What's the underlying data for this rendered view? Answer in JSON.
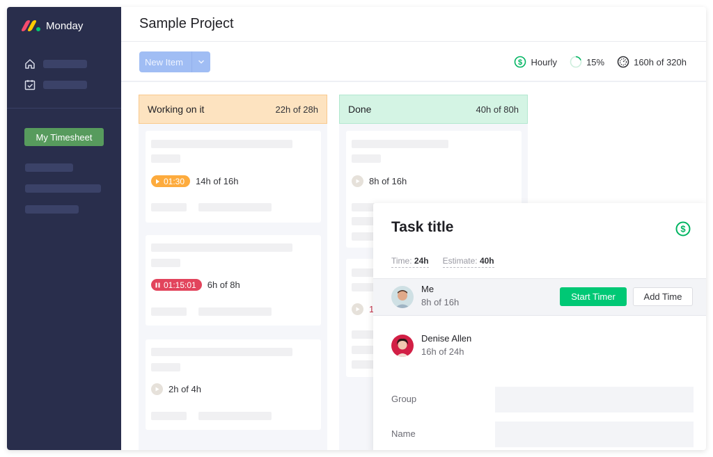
{
  "app": {
    "name": "Monday",
    "logo_colors": [
      "#f64b6c",
      "#ffcb00",
      "#00ca72"
    ]
  },
  "sidebar": {
    "nav_icons": [
      "home-icon",
      "calendar-check-icon"
    ],
    "active_button": "My Timesheet"
  },
  "header": {
    "title": "Sample Project"
  },
  "toolbar": {
    "new_item_label": "New Item",
    "stats": {
      "billing": "Hourly",
      "progress": "15%",
      "hours": "160h of 320h"
    }
  },
  "columns": [
    {
      "name": "Working on it",
      "hours": "22h of 28h",
      "header_color": "#fde3c0",
      "cards": [
        {
          "timer": "01:30",
          "timer_state": "running",
          "timer_color": "#fdab3d",
          "hours": "14h of 16h"
        },
        {
          "timer": "01:15:01",
          "timer_state": "paused",
          "timer_color": "#e2445c",
          "hours": "6h of 8h"
        },
        {
          "timer": "",
          "timer_state": "idle",
          "hours": "2h of 4h"
        }
      ]
    },
    {
      "name": "Done",
      "hours": "40h of 80h",
      "header_color": "#d4f4e4",
      "cards": [
        {
          "timer": "",
          "timer_state": "idle",
          "hours": "8h of 16h"
        },
        {
          "timer": "",
          "timer_state": "idle",
          "hours": "1"
        }
      ]
    }
  ],
  "task_panel": {
    "title": "Task title",
    "time_label": "Time:",
    "time_value": "24h",
    "estimate_label": "Estimate:",
    "estimate_value": "40h",
    "people": [
      {
        "name": "Me",
        "hours": "8h of 16h"
      },
      {
        "name": "Denise Allen",
        "hours": "16h of 24h"
      }
    ],
    "start_timer_label": "Start Timer",
    "add_time_label": "Add Time",
    "fields": [
      {
        "label": "Group",
        "value": ""
      },
      {
        "label": "Name",
        "value": ""
      }
    ]
  }
}
